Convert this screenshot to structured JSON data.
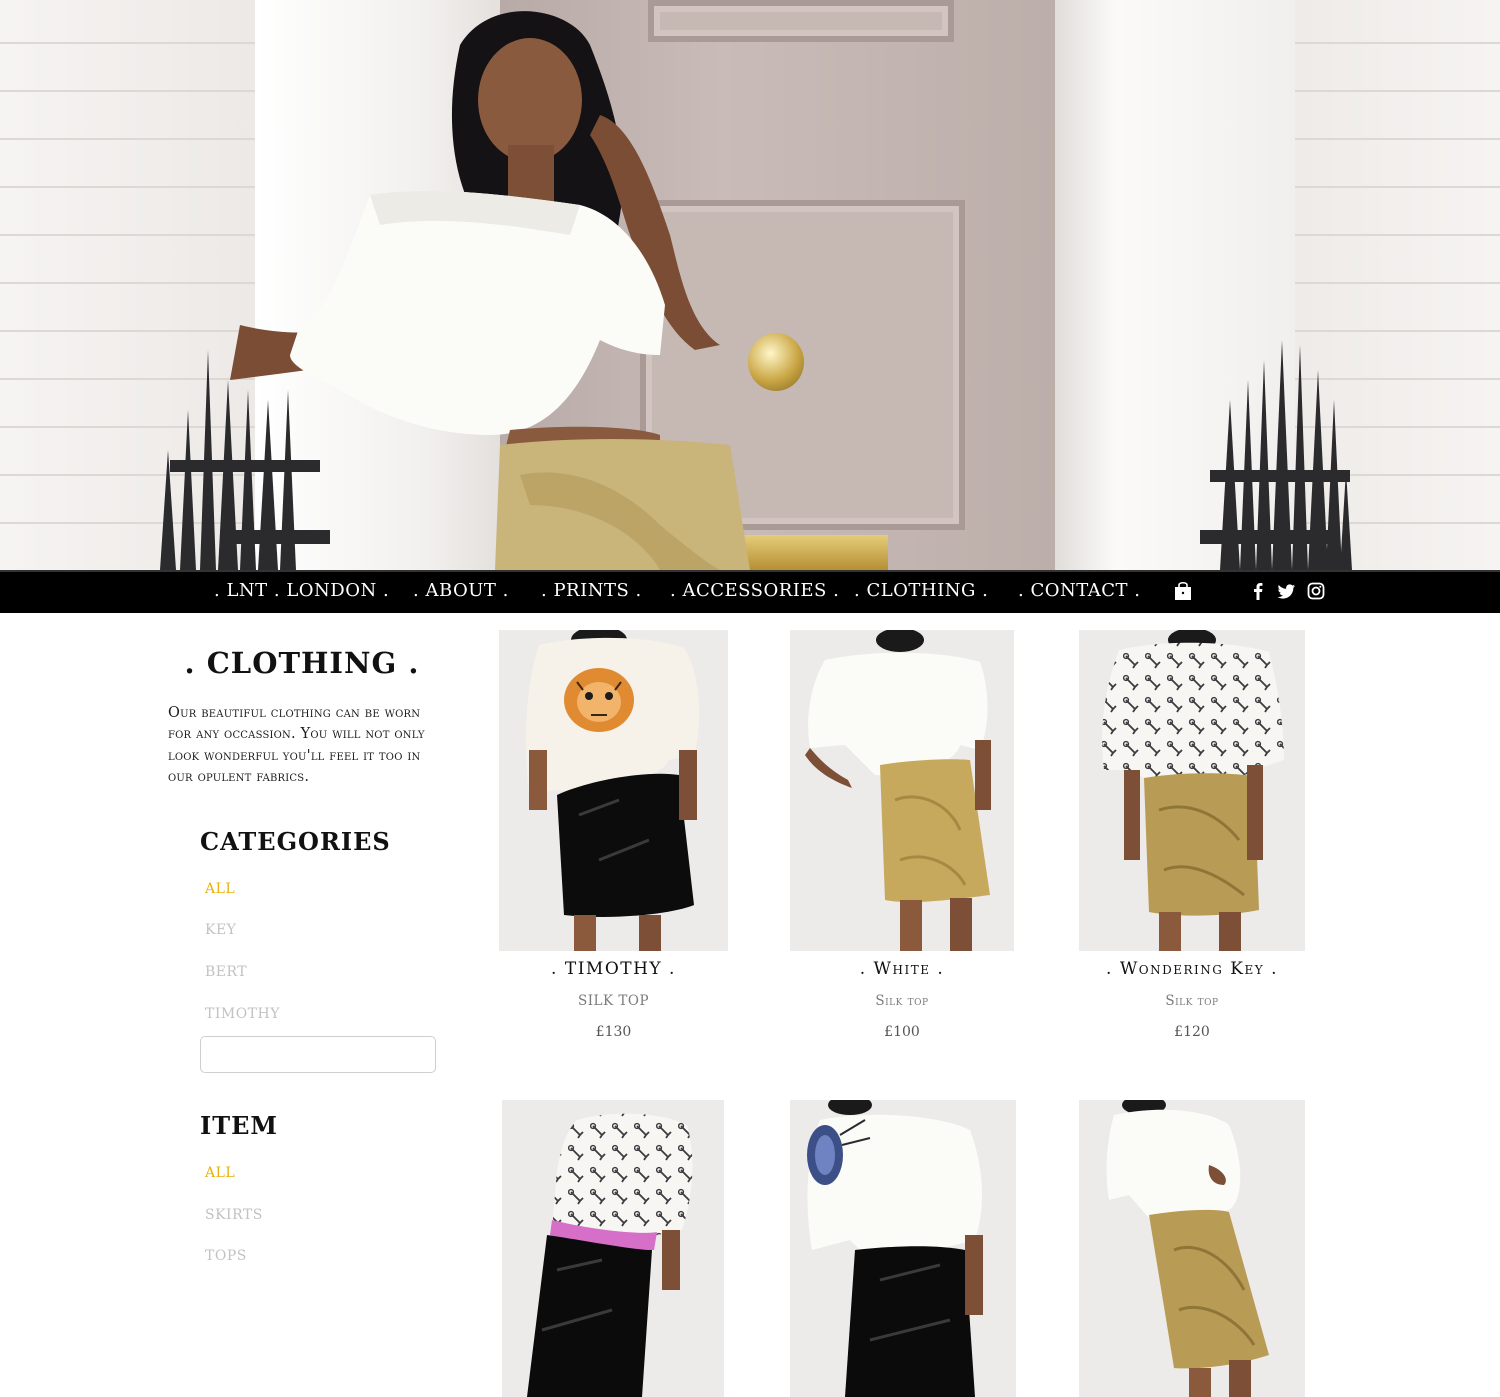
{
  "nav": {
    "items": [
      {
        "label": ". LNT . LONDON ."
      },
      {
        "label": ". ABOUT ."
      },
      {
        "label": ". PRINTS ."
      },
      {
        "label": ". ACCESSORIES ."
      },
      {
        "label": ". CLOTHING ."
      },
      {
        "label": ". CONTACT ."
      }
    ],
    "icons": [
      "shopping-bag-icon",
      "facebook-icon",
      "twitter-icon",
      "instagram-icon"
    ]
  },
  "sidebar": {
    "title": ". CLOTHING .",
    "intro": "Our beautiful clothing can be worn for any occassion. You will not only look wonderful you'll feel it too in our opulent fabrics.",
    "categories_heading": "CATEGORIES",
    "categories": [
      {
        "label": "ALL",
        "active": true
      },
      {
        "label": "KEY",
        "active": false
      },
      {
        "label": "BERT",
        "active": false
      },
      {
        "label": "TIMOTHY",
        "active": false
      }
    ],
    "search_value": "",
    "item_heading": "ITEM",
    "items": [
      {
        "label": "ALL",
        "active": true
      },
      {
        "label": "SKIRTS",
        "active": false
      },
      {
        "label": "TOPS",
        "active": false
      }
    ]
  },
  "products": [
    {
      "name": ". TIMOTHY .",
      "type": "SILK TOP",
      "price": "£130"
    },
    {
      "name": ". White .",
      "type": "Silk top",
      "price": "£100"
    },
    {
      "name": ". Wondering Key .",
      "type": "Silk top",
      "price": "£120"
    },
    {
      "name": "",
      "type": "",
      "price": ""
    },
    {
      "name": "",
      "type": "",
      "price": ""
    },
    {
      "name": "",
      "type": "",
      "price": ""
    }
  ],
  "colors": {
    "accent": "#e8b10c",
    "nav_bg": "#000000",
    "inactive_link": "#c2c2c2"
  }
}
